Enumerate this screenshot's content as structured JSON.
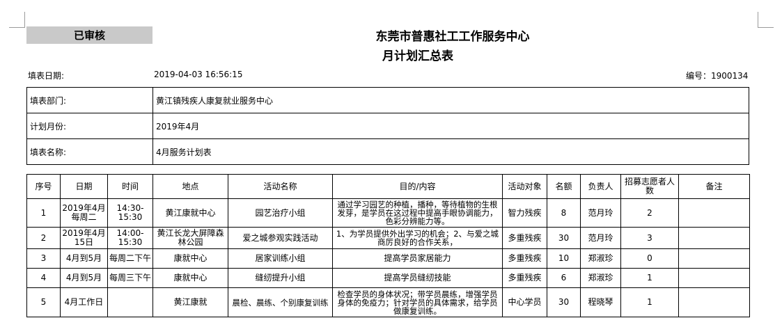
{
  "header": {
    "stamp": "已审核",
    "org": "东莞市普惠社工工作服务中心",
    "title": "月计划汇总表",
    "date_label": "填表日期:",
    "date_value": "2019-04-03 16:56:15",
    "number": "编号：1900134"
  },
  "info": [
    {
      "label": "填表部门:",
      "value": "黄江镇残疾人康复就业服务中心"
    },
    {
      "label": "计划月份:",
      "value": "2019年4月"
    },
    {
      "label": "填表名称:",
      "value": "4月服务计划表"
    }
  ],
  "table": {
    "headers": [
      "序号",
      "日期",
      "时间",
      "地点",
      "活动名称",
      "目的/内容",
      "活动对象",
      "名额",
      "负责人",
      "招募志愿者人数",
      "备注"
    ],
    "rows": [
      {
        "no": "1",
        "date": "2019年4月每周二",
        "time": "14:30-15:30",
        "place": "黄江康就中心",
        "activity": "园艺治疗小组",
        "content": "通过学习园艺的种植，播种，等待植物的生根发芽，是学员在这过程中提高手眼协调能力，色彩分辨能力等。",
        "target": "智力残疾",
        "quota": "8",
        "owner": "范月玲",
        "volunteers": "2",
        "note": ""
      },
      {
        "no": "2",
        "date": "2019年4月15日",
        "time": "14:00-15:30",
        "place": "黄江长龙大屏障森林公园",
        "activity": "爱之城参观实践活动",
        "content": "1、为学员提供外出学习的机会；2、与爱之城商厉良好的合作关系，",
        "target": "多重残疾",
        "quota": "30",
        "owner": "范月玲",
        "volunteers": "3",
        "note": ""
      },
      {
        "no": "3",
        "date": "4月到5月",
        "time": "每周二下午",
        "place": "康就中心",
        "activity": "居家训练小组",
        "content": "提高学员家居能力",
        "target": "多重残疾",
        "quota": "10",
        "owner": "郑淑珍",
        "volunteers": "0",
        "note": ""
      },
      {
        "no": "4",
        "date": "4月到5月",
        "time": "每周三下午",
        "place": "康就中心",
        "activity": "缝纫提升小组",
        "content": "提高学员缝纫技能",
        "target": "多重残疾",
        "quota": "6",
        "owner": "郑淑珍",
        "volunteers": "1",
        "note": ""
      },
      {
        "no": "5",
        "date": "4月工作日",
        "time": "",
        "place": "黄江康就",
        "activity": "晨检、晨练、个别康复训练",
        "content": "检查学员的身体状况；带学员晨练，增强学员身体的免疫力；针对学员的具体需求，给学员做康复训练。",
        "target": "中心学员",
        "quota": "30",
        "owner": "程晓琴",
        "volunteers": "1",
        "note": ""
      }
    ]
  }
}
